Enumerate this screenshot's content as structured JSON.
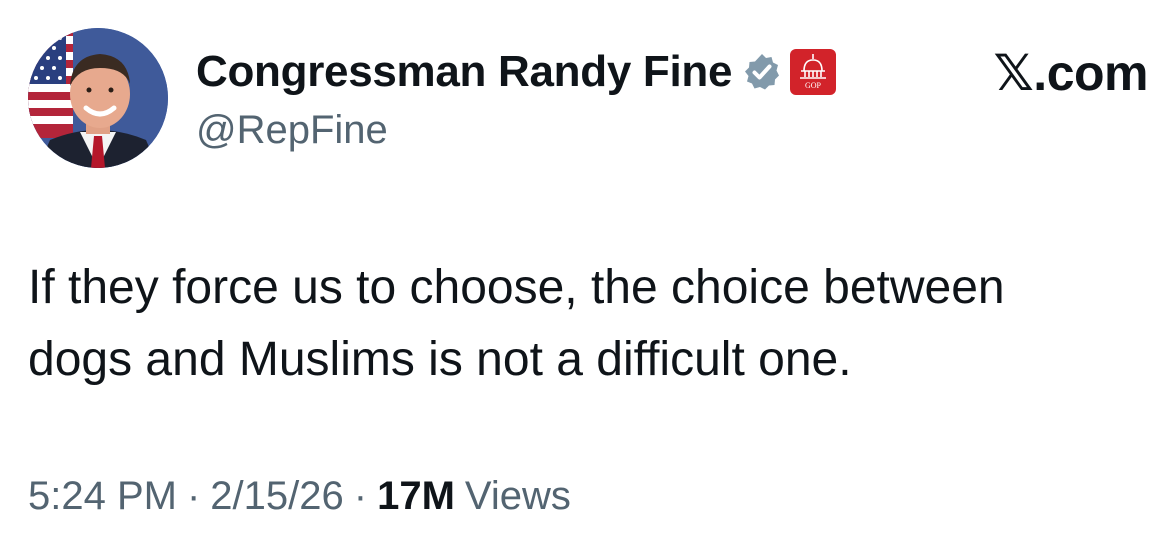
{
  "author": {
    "display_name": "Congressman Randy Fine",
    "handle": "@RepFine",
    "verified_icon": "verified-check-badge-icon",
    "affiliation_icon": "house-gop-capitol-badge-icon",
    "affiliation_badge_text": "GOP"
  },
  "site": {
    "logo_text": "𝕏.com"
  },
  "tweet": {
    "text_lines": [
      "If they force us to choose, the choice between",
      "dogs and Muslims is not a difficult one."
    ]
  },
  "meta": {
    "time": "5:24 PM",
    "separator": "·",
    "date": "2/15/26",
    "views_count": "17M",
    "views_label": "Views"
  },
  "colors": {
    "text_primary": "#0f1419",
    "text_secondary": "#536471",
    "verified_badge": "#829aab",
    "gop_badge": "#d2232a"
  }
}
